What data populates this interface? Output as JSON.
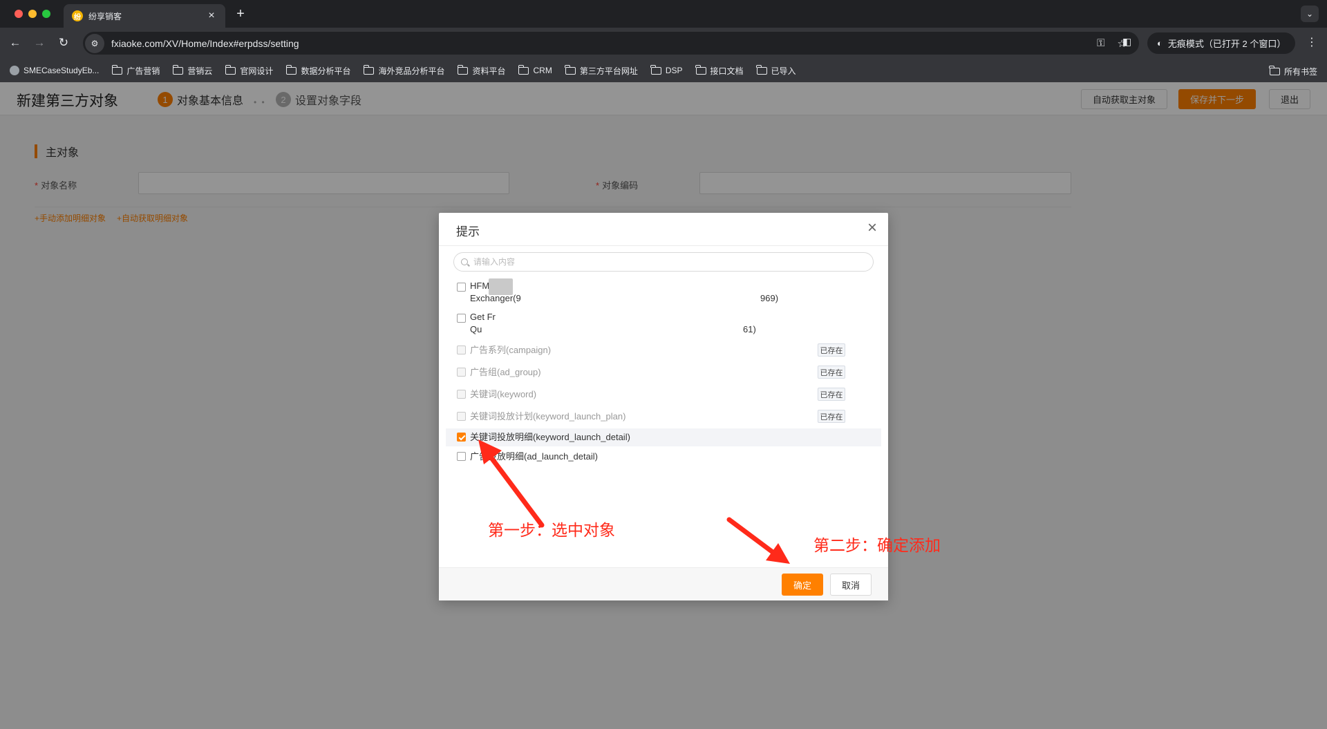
{
  "browser": {
    "tab_title": "纷享销客",
    "tab_favicon": "纷",
    "url": "fxiaoke.com/XV/Home/Index#erpdss/setting",
    "incognito_label": "无痕模式（已打开 2 个窗口）",
    "bookmarks": [
      "SMECaseStudyEb...",
      "广告营销",
      "营销云",
      "官网设计",
      "数据分析平台",
      "海外竞品分析平台",
      "资料平台",
      "CRM",
      "第三方平台网址",
      "DSP",
      "接口文档",
      "已导入"
    ],
    "all_bookmarks": "所有书签"
  },
  "app": {
    "page_title": "新建第三方对象",
    "steps": [
      {
        "num": "1",
        "label": "对象基本信息"
      },
      {
        "num": "2",
        "label": "设置对象字段"
      }
    ],
    "header_buttons": {
      "auto_get_main": "自动获取主对象",
      "save_next": "保存并下一步",
      "exit": "退出"
    },
    "section_title": "主对象",
    "fields": {
      "object_name_label": "对象名称",
      "object_code_label": "对象编码",
      "required_mark": "*"
    },
    "links": {
      "manual_add_detail": "+手动添加明细对象",
      "auto_get_detail": "+自动获取明细对象"
    }
  },
  "modal": {
    "title": "提示",
    "search_placeholder": "请输入内容",
    "items": [
      {
        "line1": "HFM",
        "line2": "Exchanger(9",
        "tail": "969)",
        "checked": false,
        "disabled": false,
        "exists": false
      },
      {
        "line1": "Get Fr",
        "line2": "Qu",
        "tail": "61)",
        "checked": false,
        "disabled": false,
        "exists": false
      },
      {
        "text": "广告系列(campaign)",
        "checked": false,
        "disabled": true,
        "exists": true
      },
      {
        "text": "广告组(ad_group)",
        "checked": false,
        "disabled": true,
        "exists": true
      },
      {
        "text": "关键词(keyword)",
        "checked": false,
        "disabled": true,
        "exists": true
      },
      {
        "text": "关键词投放计划(keyword_launch_plan)",
        "checked": false,
        "disabled": true,
        "exists": true
      },
      {
        "text": "关键词投放明细(keyword_launch_detail)",
        "checked": true,
        "disabled": false,
        "exists": false
      },
      {
        "text": "广告投放明细(ad_launch_detail)",
        "checked": false,
        "disabled": false,
        "exists": false
      }
    ],
    "exists_label": "已存在",
    "ok_label": "确定",
    "cancel_label": "取消"
  },
  "annotations": {
    "step1": "第一步：选中对象",
    "step2": "第二步：确定添加",
    "color": "#ff2a1a"
  },
  "colors": {
    "accent": "#ff8000",
    "overlay": "rgba(0,0,0,0.42)"
  }
}
